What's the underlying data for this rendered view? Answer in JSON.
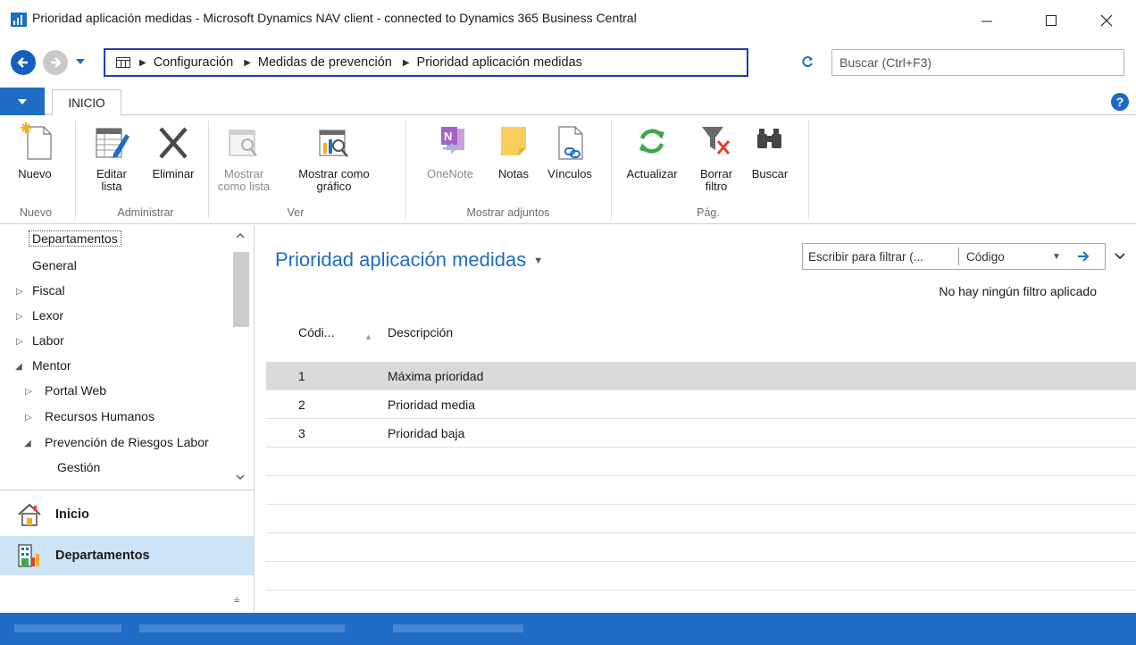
{
  "window": {
    "title": "Prioridad aplicación medidas - Microsoft Dynamics NAV client - connected to Dynamics 365 Business Central"
  },
  "address": {
    "crumbs": [
      "Configuración",
      "Medidas de prevención",
      "Prioridad aplicación medidas"
    ],
    "search_placeholder": "Buscar (Ctrl+F3)"
  },
  "ribbon": {
    "tab": "INICIO",
    "help": "?",
    "buttons": {
      "nuevo": [
        "Nuevo",
        ""
      ],
      "editar": [
        "Editar",
        "lista"
      ],
      "eliminar": [
        "Eliminar",
        ""
      ],
      "mostrar_lista": [
        "Mostrar",
        "como lista"
      ],
      "mostrar_grafico": [
        "Mostrar como",
        "gráfico"
      ],
      "onenote": [
        "OneNote",
        ""
      ],
      "notas": [
        "Notas",
        ""
      ],
      "vinculos": [
        "Vínculos",
        ""
      ],
      "actualizar": [
        "Actualizar",
        ""
      ],
      "borrar_filtro": [
        "Borrar",
        "filtro"
      ],
      "buscar": [
        "Buscar",
        ""
      ]
    },
    "groups": {
      "nuevo": "Nuevo",
      "administrar": "Administrar",
      "ver": "Ver",
      "adjuntos": "Mostrar adjuntos",
      "pag": "Pág."
    }
  },
  "nav": {
    "tree": {
      "departamentos": "Departamentos",
      "general": "General",
      "fiscal": "Fiscal",
      "lexor": "Lexor",
      "labor": "Labor",
      "mentor": "Mentor",
      "portal_web": "Portal Web",
      "rrhh": "Recursos Humanos",
      "prevencion": "Prevención de Riesgos Labor",
      "gestion": "Gestión"
    },
    "buttons": {
      "inicio": "Inicio",
      "departamentos": "Departamentos"
    }
  },
  "main": {
    "title": "Prioridad aplicación medidas",
    "filter": {
      "placeholder": "Escribir para filtrar (...",
      "field": "Código"
    },
    "no_filter": "No hay ningún filtro aplicado",
    "columns": {
      "code": "Códi...",
      "desc": "Descripción"
    },
    "rows": [
      {
        "code": "1",
        "desc": "Máxima prioridad"
      },
      {
        "code": "2",
        "desc": "Prioridad media"
      },
      {
        "code": "3",
        "desc": "Prioridad baja"
      }
    ]
  },
  "colors": {
    "accent": "#1f6dc4",
    "breadcrumb_border": "#1b3db8",
    "selected_row": "#dadada",
    "selected_nav": "#cde4f7"
  }
}
